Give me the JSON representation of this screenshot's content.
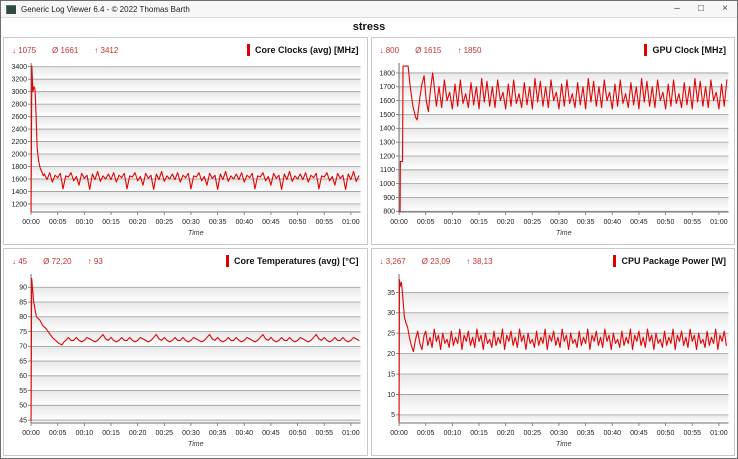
{
  "window": {
    "title": "Generic Log Viewer 6.4 - © 2022 Thomas Barth",
    "controls": {
      "minimize": "–",
      "maximize": "□",
      "close": "×"
    }
  },
  "page_title": "stress",
  "stats_symbols": {
    "min": "↓",
    "avg": "Ø",
    "max": "↑"
  },
  "colors": {
    "series": "#e10505",
    "stats_text": "#c83232",
    "legend_bar": "#dd0000",
    "grid_line": "#9b9b9b",
    "band_top": "#e7e7e7",
    "band_bottom": "#ffffff",
    "axis_line": "#707070",
    "tick_text": "#222222"
  },
  "time_axis": {
    "label": "Time",
    "domain_minutes": [
      0,
      61.8
    ],
    "tick_minutes": [
      0,
      5,
      10,
      15,
      20,
      25,
      30,
      35,
      40,
      45,
      50,
      55,
      60
    ],
    "tick_labels": [
      "00:00",
      "00:05",
      "00:10",
      "00:15",
      "00:20",
      "00:25",
      "00:30",
      "00:35",
      "00:40",
      "00:45",
      "00:50",
      "00:55",
      "01:00"
    ]
  },
  "chart_data": [
    {
      "type": "line",
      "title": "Core Clocks (avg) [MHz]",
      "stats": {
        "min": "1075",
        "avg": "1661",
        "max": "3412"
      },
      "xlabel": "Time",
      "ylim": [
        1070,
        3460
      ],
      "yticks": [
        1200,
        1400,
        1600,
        1800,
        2000,
        2200,
        2400,
        2600,
        2800,
        3000,
        3200,
        3400
      ],
      "points_lead": [
        [
          0,
          1075
        ],
        [
          0.15,
          3412
        ],
        [
          0.35,
          3000
        ],
        [
          0.55,
          3080
        ],
        [
          0.75,
          3040
        ],
        [
          0.95,
          2600
        ],
        [
          1.15,
          2100
        ],
        [
          1.4,
          1900
        ],
        [
          1.7,
          1780
        ],
        [
          2.0,
          1720
        ],
        [
          2.3,
          1650
        ]
      ],
      "points_pattern": {
        "t_start": 2.5,
        "t_end": 61.5,
        "t_step": 0.5,
        "values": [
          1680,
          1590,
          1700,
          1550,
          1660,
          1620,
          1690,
          1440,
          1650,
          1630,
          1700,
          1570,
          1640,
          1500,
          1690,
          1610,
          1660,
          1430,
          1680,
          1590,
          1720,
          1560,
          1650,
          1600
        ]
      }
    },
    {
      "type": "line",
      "title": "GPU Clock [MHz]",
      "stats": {
        "min": "800",
        "avg": "1615",
        "max": "1850"
      },
      "xlabel": "Time",
      "ylim": [
        795,
        1872
      ],
      "yticks": [
        800,
        900,
        1000,
        1100,
        1200,
        1300,
        1400,
        1500,
        1600,
        1700,
        1800
      ],
      "points_lead": [
        [
          0,
          800
        ],
        [
          0.2,
          800
        ],
        [
          0.25,
          1160
        ],
        [
          0.65,
          1160
        ],
        [
          0.75,
          1850
        ],
        [
          1.7,
          1850
        ],
        [
          2.1,
          1700
        ],
        [
          2.6,
          1560
        ],
        [
          3.1,
          1480
        ],
        [
          3.4,
          1460
        ],
        [
          3.9,
          1620
        ],
        [
          4.3,
          1720
        ],
        [
          4.7,
          1780
        ],
        [
          5.1,
          1600
        ],
        [
          5.5,
          1520
        ],
        [
          5.9,
          1680
        ],
        [
          6.3,
          1800
        ]
      ],
      "points_pattern": {
        "t_start": 6.5,
        "t_end": 61.5,
        "t_step": 0.5,
        "values": [
          1740,
          1560,
          1700,
          1550,
          1750,
          1600,
          1660,
          1540,
          1720,
          1560,
          1750,
          1580,
          1650,
          1550,
          1730,
          1570,
          1700,
          1540,
          1760,
          1590
        ]
      }
    },
    {
      "type": "line",
      "title": "Core Temperatures (avg) [°C]",
      "stats": {
        "min": "45",
        "avg": "72,20",
        "max": "93"
      },
      "xlabel": "Time",
      "ylim": [
        44,
        94.5
      ],
      "yticks": [
        45,
        50,
        55,
        60,
        65,
        70,
        75,
        80,
        85,
        90
      ],
      "points_lead": [
        [
          0,
          45
        ],
        [
          0.12,
          93
        ],
        [
          0.5,
          85
        ],
        [
          1.0,
          80
        ],
        [
          1.6,
          79
        ],
        [
          2.2,
          77
        ],
        [
          2.8,
          76
        ],
        [
          3.4,
          74.5
        ],
        [
          4.0,
          73
        ],
        [
          4.6,
          72
        ],
        [
          5.2,
          71
        ],
        [
          5.8,
          70.5
        ],
        [
          6.2,
          71.5
        ]
      ],
      "points_pattern": {
        "t_start": 6.5,
        "t_end": 61.5,
        "t_step": 0.5,
        "values": [
          72,
          73,
          72,
          72,
          73,
          72,
          71.5,
          72,
          73,
          72.5,
          72,
          71.5,
          72,
          73,
          74,
          72.5,
          72,
          73,
          72,
          71.5
        ]
      }
    },
    {
      "type": "line",
      "title": "CPU Package Power [W]",
      "stats": {
        "min": "3,267",
        "avg": "23,09",
        "max": "38,13"
      },
      "xlabel": "Time",
      "ylim": [
        3.0,
        39.5
      ],
      "yticks": [
        5,
        10,
        15,
        20,
        25,
        30,
        35
      ],
      "points_lead": [
        [
          0,
          3.3
        ],
        [
          0.08,
          38.1
        ],
        [
          0.25,
          36.5
        ],
        [
          0.45,
          37.5
        ],
        [
          0.7,
          34
        ],
        [
          1.0,
          29
        ],
        [
          1.3,
          27.5
        ],
        [
          1.6,
          26.5
        ],
        [
          1.95,
          24
        ],
        [
          2.3,
          22
        ],
        [
          2.7,
          20.5
        ],
        [
          3.1,
          23.5
        ],
        [
          3.5,
          25.5
        ],
        [
          3.9,
          22.5
        ],
        [
          4.3,
          21
        ],
        [
          4.7,
          24.5
        ]
      ],
      "points_pattern": {
        "t_start": 5.0,
        "t_end": 61.4,
        "t_step": 0.4,
        "values": [
          25.5,
          22,
          24,
          21.5,
          26,
          23,
          24.5,
          21,
          25,
          22.5,
          23.5,
          21.5,
          25.5,
          22,
          24,
          22.5,
          26,
          21,
          24.5,
          23
        ]
      }
    }
  ]
}
